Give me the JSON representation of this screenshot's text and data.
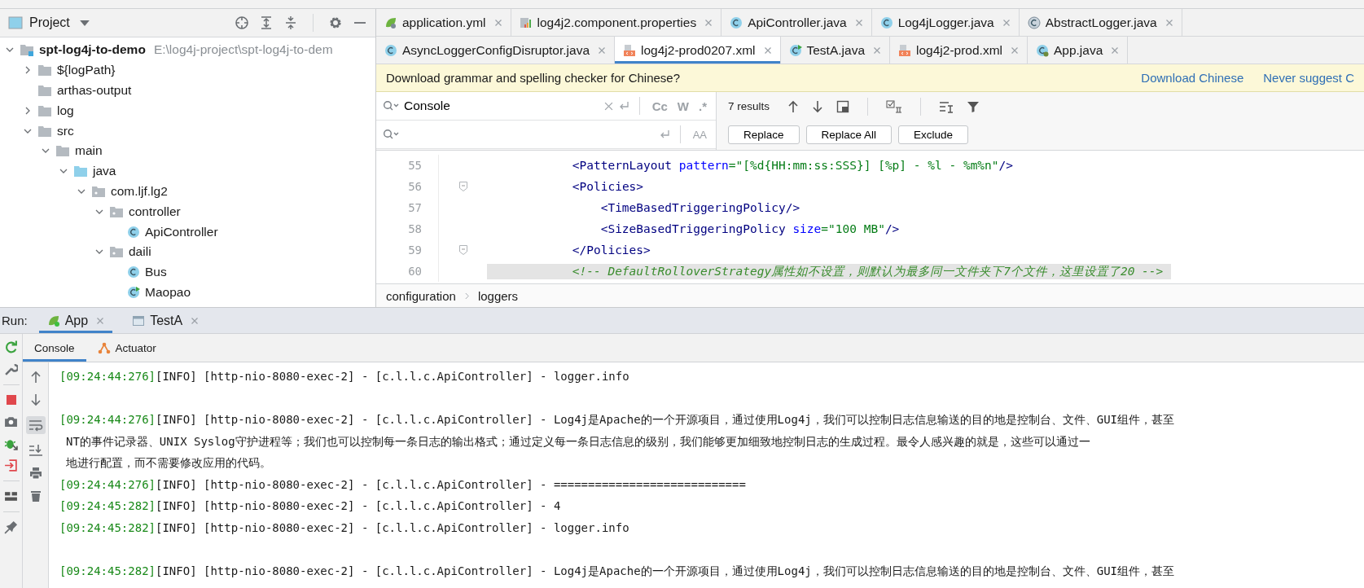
{
  "project_panel": {
    "title": "Project",
    "tree": [
      {
        "label": "spt-log4j-to-demo",
        "hint": "E:\\log4j-project\\spt-log4j-to-dem",
        "kind": "module",
        "expanded": true,
        "children": [
          {
            "label": "${logPath}",
            "kind": "folder",
            "expanded": false
          },
          {
            "label": "arthas-output",
            "kind": "folder"
          },
          {
            "label": "log",
            "kind": "folder",
            "expanded": false
          },
          {
            "label": "src",
            "kind": "folder",
            "expanded": true,
            "children": [
              {
                "label": "main",
                "kind": "folder",
                "expanded": true,
                "children": [
                  {
                    "label": "java",
                    "kind": "source-folder",
                    "expanded": true,
                    "children": [
                      {
                        "label": "com.ljf.lg2",
                        "kind": "package",
                        "expanded": true,
                        "children": [
                          {
                            "label": "controller",
                            "kind": "package",
                            "expanded": true,
                            "children": [
                              {
                                "label": "ApiController",
                                "kind": "class"
                              }
                            ]
                          },
                          {
                            "label": "daili",
                            "kind": "package",
                            "expanded": true,
                            "children": [
                              {
                                "label": "Bus",
                                "kind": "class"
                              },
                              {
                                "label": "Maopao",
                                "kind": "runnable-class"
                              }
                            ]
                          }
                        ]
                      }
                    ]
                  }
                ]
              }
            ]
          }
        ]
      }
    ]
  },
  "editor": {
    "tab_rows": [
      [
        {
          "name": "application.yml",
          "kind": "spring",
          "selected": false
        },
        {
          "name": "log4j2.component.properties",
          "kind": "properties",
          "selected": false
        },
        {
          "name": "ApiController.java",
          "kind": "class",
          "selected": false
        },
        {
          "name": "Log4jLogger.java",
          "kind": "class",
          "selected": false
        },
        {
          "name": "AbstractLogger.java",
          "kind": "abstract-class",
          "selected": false
        }
      ],
      [
        {
          "name": "AsyncLoggerConfigDisruptor.java",
          "kind": "class",
          "selected": false
        },
        {
          "name": "log4j2-prod0207.xml",
          "kind": "xml",
          "selected": true
        },
        {
          "name": "TestA.java",
          "kind": "runnable-class",
          "selected": false
        },
        {
          "name": "log4j2-prod.xml",
          "kind": "xml",
          "selected": false
        },
        {
          "name": "App.java",
          "kind": "spring-class",
          "selected": false
        }
      ]
    ],
    "notification": {
      "text": "Download grammar and spelling checker for Chinese?",
      "links": [
        "Download Chinese",
        "Never suggest C"
      ]
    },
    "find": {
      "search_value": "Console",
      "options": [
        {
          "label": "Cc",
          "selected": false
        },
        {
          "label": "W",
          "selected": false
        },
        {
          "label": ".*",
          "selected": false
        }
      ],
      "case_label": "AA",
      "results": "7 results",
      "buttons": [
        "Replace",
        "Replace All",
        "Exclude"
      ]
    },
    "lines": [
      {
        "number": "55",
        "fold_marker": false,
        "highlighted": false,
        "tokens": [
          {
            "kind": "bracket",
            "text": "            <"
          },
          {
            "kind": "tag",
            "text": "PatternLayout "
          },
          {
            "kind": "attr",
            "text": "pattern"
          },
          {
            "kind": "value",
            "text": "=\"[%d{HH:mm:ss:SSS}] [%p] - %l - %m%n\""
          },
          {
            "kind": "bracket",
            "text": "/>"
          }
        ]
      },
      {
        "number": "56",
        "fold_marker": true,
        "highlighted": false,
        "tokens": [
          {
            "kind": "bracket",
            "text": "            <"
          },
          {
            "kind": "tag",
            "text": "Policies"
          },
          {
            "kind": "bracket",
            "text": ">"
          }
        ]
      },
      {
        "number": "57",
        "fold_marker": false,
        "highlighted": false,
        "tokens": [
          {
            "kind": "bracket",
            "text": "                <"
          },
          {
            "kind": "tag",
            "text": "TimeBasedTriggeringPolicy"
          },
          {
            "kind": "bracket",
            "text": "/>"
          }
        ]
      },
      {
        "number": "58",
        "fold_marker": false,
        "highlighted": false,
        "tokens": [
          {
            "kind": "bracket",
            "text": "                <"
          },
          {
            "kind": "tag",
            "text": "SizeBasedTriggeringPolicy "
          },
          {
            "kind": "attr",
            "text": "size"
          },
          {
            "kind": "value",
            "text": "=\"100 MB\""
          },
          {
            "kind": "bracket",
            "text": "/>"
          }
        ]
      },
      {
        "number": "59",
        "fold_marker": true,
        "highlighted": false,
        "tokens": [
          {
            "kind": "bracket",
            "text": "            </"
          },
          {
            "kind": "tag",
            "text": "Policies"
          },
          {
            "kind": "bracket",
            "text": ">"
          }
        ]
      },
      {
        "number": "60",
        "fold_marker": false,
        "highlighted": true,
        "tokens": [
          {
            "kind": "comment",
            "text": "            <!-- DefaultRolloverStrategy属性如不设置，则默认为最多同一文件夹下7个文件，这里设置了20 -->"
          }
        ]
      }
    ],
    "breadcrumb": [
      "configuration",
      "loggers"
    ]
  },
  "run_panel": {
    "label": "Run:",
    "tabs": [
      {
        "name": "App",
        "kind": "spring-app",
        "selected": true
      },
      {
        "name": "TestA",
        "kind": "window",
        "selected": false
      }
    ],
    "subtabs": [
      {
        "name": "Console",
        "kind": "plain",
        "selected": true
      },
      {
        "name": "Actuator",
        "kind": "actuator",
        "selected": false
      }
    ],
    "soft_wrap_on": true,
    "console": [
      {
        "gap_before": false,
        "timestamp": "[09:24:44:276]",
        "lines": [
          "[INFO] [http-nio-8080-exec-2] - [c.l.l.c.ApiController] - logger.info"
        ]
      },
      {
        "gap_before": true,
        "timestamp": "[09:24:44:276]",
        "lines": [
          "[INFO] [http-nio-8080-exec-2] - [c.l.l.c.ApiController] - Log4j是Apache的一个开源项目，通过使用Log4j，我们可以控制日志信息输送的目的地是控制台、文件、GUI组件，甚至",
          "NT的事件记录器、UNIX Syslog守护进程等；我们也可以控制每一条日志的输出格式；通过定义每一条日志信息的级别，我们能够更加细致地控制日志的生成过程。最令人感兴趣的就是，这些可以通过一",
          "地进行配置，而不需要修改应用的代码。"
        ]
      },
      {
        "gap_before": false,
        "timestamp": "[09:24:44:276]",
        "lines": [
          "[INFO] [http-nio-8080-exec-2] - [c.l.l.c.ApiController] - ============================"
        ]
      },
      {
        "gap_before": false,
        "timestamp": "[09:24:45:282]",
        "lines": [
          "[INFO] [http-nio-8080-exec-2] - [c.l.l.c.ApiController] - 4"
        ]
      },
      {
        "gap_before": false,
        "timestamp": "[09:24:45:282]",
        "lines": [
          "[INFO] [http-nio-8080-exec-2] - [c.l.l.c.ApiController] - logger.info"
        ]
      },
      {
        "gap_before": true,
        "timestamp": "[09:24:45:282]",
        "lines": [
          "[INFO] [http-nio-8080-exec-2] - [c.l.l.c.ApiController] - Log4j是Apache的一个开源项目，通过使用Log4j，我们可以控制日志信息输送的目的地是控制台、文件、GUI组件，甚至"
        ]
      }
    ]
  }
}
